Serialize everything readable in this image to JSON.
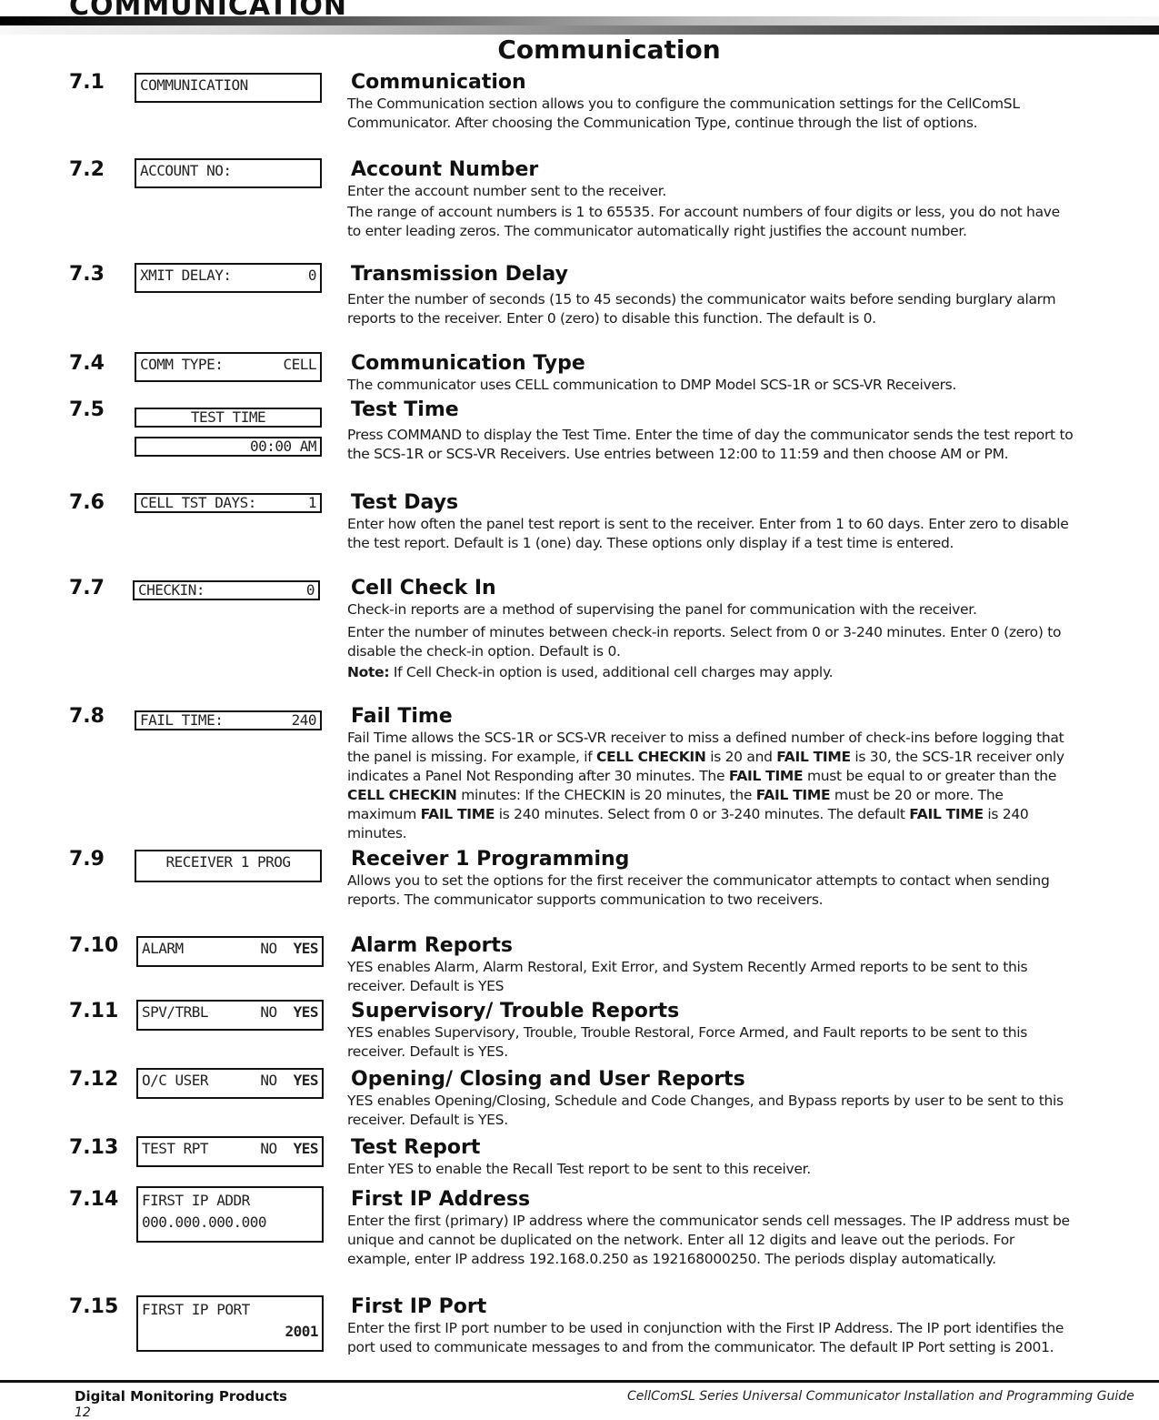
{
  "header": {
    "chapter": "COMMUNICATION",
    "page_heading": "Communication"
  },
  "entries": [
    {
      "number": "7.1",
      "lcd": {
        "left": "COMMUNICATION",
        "right": ""
      },
      "title": "Communication",
      "paragraphs": [
        "The Communication section allows you to configure the communication settings for the CellComSL Communicator. After choosing the Communication Type, continue through the list of options."
      ]
    },
    {
      "number": "7.2",
      "lcd": {
        "left": "ACCOUNT NO:",
        "right": ""
      },
      "title": "Account Number",
      "paragraphs": [
        "Enter the account number sent to the receiver.",
        "The range of account numbers is 1 to 65535. For account numbers of four digits or less, you do not have to enter leading zeros. The communicator automatically right justifies the account number."
      ]
    },
    {
      "number": "7.3",
      "lcd": {
        "left": "XMIT DELAY:",
        "right": "0"
      },
      "title": "Transmission Delay",
      "paragraphs": [
        "Enter the number of seconds (15 to 45 seconds) the communicator waits before sending burglary alarm reports to the receiver. Enter 0 (zero) to disable this function. The default is 0."
      ]
    },
    {
      "number": "7.4",
      "lcd": {
        "left": "COMM TYPE:",
        "right": "CELL"
      },
      "title": "Communication Type",
      "paragraphs": [
        "The communicator uses CELL communication to DMP Model SCS-1R or SCS-VR Receivers."
      ]
    },
    {
      "number": "7.5",
      "lcd": {
        "line1": "TEST TIME",
        "line2": "00:00 AM"
      },
      "title": "Test Time",
      "paragraphs": [
        "Press COMMAND to display the Test Time. Enter the time of day the communicator sends the test report to the SCS-1R or SCS-VR Receivers. Use entries between 12:00 to 11:59 and then choose AM or PM."
      ]
    },
    {
      "number": "7.6",
      "lcd": {
        "left": "CELL TST DAYS:",
        "right": "1"
      },
      "title": "Test Days",
      "paragraphs": [
        "Enter how often the panel test report is sent to the receiver. Enter from 1 to 60 days. Enter zero to disable the test report. Default is 1 (one) day. These options only display if a test time is entered."
      ]
    },
    {
      "number": "7.7",
      "lcd": {
        "left": "CHECKIN:",
        "right": "0"
      },
      "title": "Cell Check In",
      "paragraphs": [
        "Check-in reports are a method of supervising the panel for communication with the receiver.",
        "Enter the number of minutes between check-in reports. Select from 0 or 3-240 minutes. Enter 0 (zero) to disable the check-in option. Default is 0."
      ],
      "note_label": "Note:",
      "note_text": " If Cell Check-in option is used, additional cell charges may apply."
    },
    {
      "number": "7.8",
      "lcd": {
        "left": "FAIL TIME:",
        "right": "240"
      },
      "title": "Fail Time",
      "rich": [
        {
          "t": "Fail Time allows the SCS-1R or SCS-VR receiver to miss a defined number of check-ins before logging that the panel is missing. For example, if "
        },
        {
          "b": "CELL CHECKIN"
        },
        {
          "t": " is 20 and "
        },
        {
          "b": "FAIL TIME"
        },
        {
          "t": " is 30, the SCS-1R receiver only indicates a Panel Not Responding after 30 minutes. The "
        },
        {
          "b": "FAIL TIME"
        },
        {
          "t": " must be equal to or greater than the "
        },
        {
          "b": "CELL CHECKIN"
        },
        {
          "t": " minutes: If the CHECKIN is 20 minutes, the "
        },
        {
          "b": "FAIL TIME"
        },
        {
          "t": " must be 20 or more. The maximum "
        },
        {
          "b": "FAIL TIME"
        },
        {
          "t": " is 240 minutes. Select from 0 or 3-240 minutes. The default "
        },
        {
          "b": "FAIL TIME"
        },
        {
          "t": " is 240 minutes."
        }
      ]
    },
    {
      "number": "7.9",
      "lcd": {
        "left": "RECEIVER 1 PROG",
        "right": ""
      },
      "title": "Receiver 1 Programming",
      "paragraphs": [
        "Allows you to set the options for the first receiver the communicator attempts to contact when sending reports. The communicator supports communication to two receivers."
      ]
    },
    {
      "number": "7.10",
      "lcd": {
        "left": "ALARM",
        "no": "NO",
        "yes": "YES"
      },
      "title": "Alarm Reports",
      "paragraphs": [
        "YES enables Alarm, Alarm Restoral, Exit Error, and System Recently Armed reports to be sent to this receiver. Default is YES"
      ]
    },
    {
      "number": "7.11",
      "lcd": {
        "left": "SPV/TRBL",
        "no": "NO",
        "yes": "YES"
      },
      "title": "Supervisory/ Trouble Reports",
      "paragraphs": [
        "YES enables Supervisory, Trouble, Trouble Restoral, Force Armed, and Fault reports to be sent to this receiver. Default is YES."
      ]
    },
    {
      "number": "7.12",
      "lcd": {
        "left": "O/C USER",
        "no": "NO",
        "yes": "YES"
      },
      "title": "Opening/ Closing and User Reports",
      "paragraphs": [
        "YES enables Opening/Closing, Schedule and Code Changes, and Bypass reports by user to be sent to this receiver. Default is YES."
      ]
    },
    {
      "number": "7.13",
      "lcd": {
        "left": "TEST RPT",
        "no": "NO",
        "yes": "YES"
      },
      "title": "Test Report",
      "paragraphs": [
        "Enter YES to enable the Recall Test report to be sent to this receiver."
      ]
    },
    {
      "number": "7.14",
      "lcd": {
        "line1": "FIRST IP ADDR",
        "line2": "000.000.000.000"
      },
      "title": "First IP Address",
      "paragraphs": [
        "Enter the first (primary) IP address where the communicator sends cell messages. The IP address must be unique and cannot be duplicated on the network. Enter all 12 digits and leave out the periods. For example, enter IP address 192.168.0.250 as 192168000250. The periods display automatically."
      ]
    },
    {
      "number": "7.15",
      "lcd": {
        "line1": "FIRST IP PORT",
        "line2": "2001"
      },
      "title": "First IP Port",
      "paragraphs": [
        "Enter the first IP port number to be used in conjunction with the First IP Address. The IP port identifies the port used to communicate messages to and from the communicator. The default IP Port setting is 2001."
      ]
    }
  ],
  "footer": {
    "company": "Digital Monitoring Products",
    "page_number": "12",
    "guide_title": "CellComSL Series Universal Communicator Installation and Programming Guide"
  }
}
